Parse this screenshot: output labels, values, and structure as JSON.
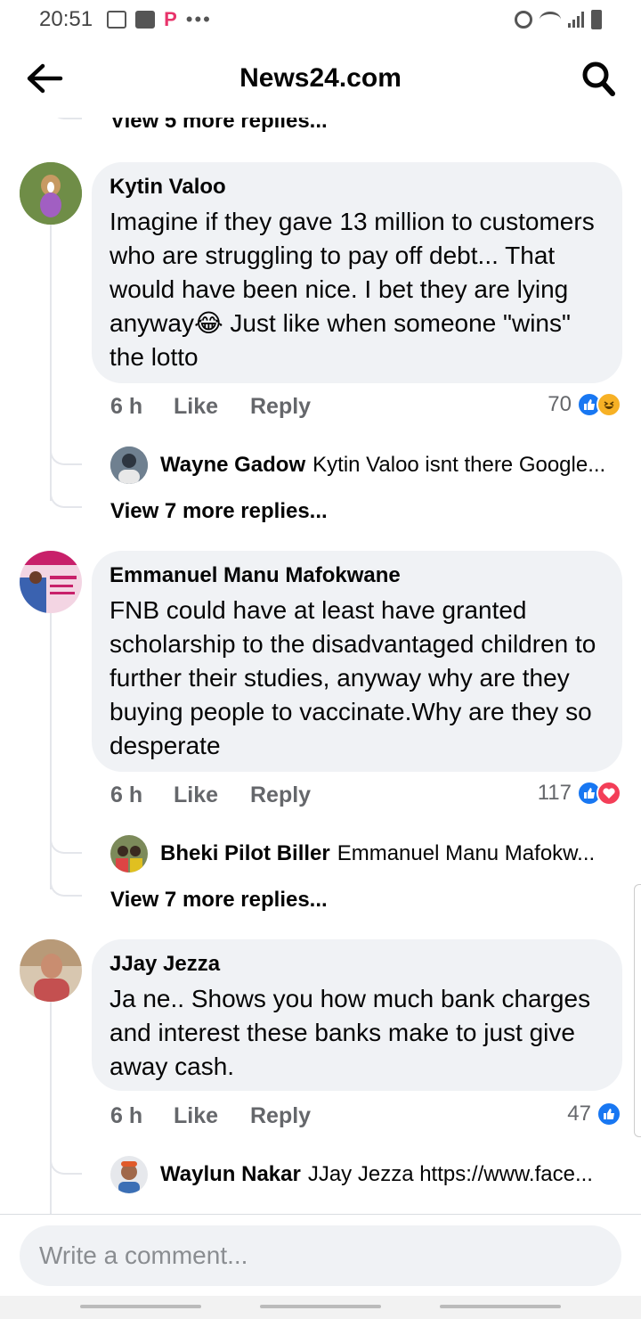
{
  "status_bar": {
    "time": "20:51",
    "extra": "•••"
  },
  "header": {
    "title": "News24.com"
  },
  "top_view_more": "View 5 more replies...",
  "comments": [
    {
      "author": "Kytin Valoo",
      "text": "Imagine if they gave 13 million to customers who are struggling to pay off debt... That would have been nice. I bet they are lying anyway😂 Just like when someone \"wins\" the lotto",
      "time": "6 h",
      "like": "Like",
      "reply": "Reply",
      "reaction_count": "70",
      "reactions": [
        "like-icon",
        "haha-icon"
      ],
      "reply_preview": {
        "author": "Wayne Gadow",
        "text": "Kytin Valoo isnt there Google..."
      },
      "view_more": "View 7 more replies..."
    },
    {
      "author": "Emmanuel Manu Mafokwane",
      "text": "FNB could have at least have granted scholarship to the disadvantaged children to further their studies, anyway why are they buying people to vaccinate.Why are they so desperate",
      "time": "6 h",
      "like": "Like",
      "reply": "Reply",
      "reaction_count": "117",
      "reactions": [
        "like-icon",
        "love-icon"
      ],
      "reply_preview": {
        "author": "Bheki Pilot Biller",
        "text": "Emmanuel Manu Mafokw..."
      },
      "view_more": "View 7 more replies..."
    },
    {
      "author": "JJay Jezza",
      "text": "Ja ne.. Shows you how much bank charges and interest these banks make to just give away cash.",
      "time": "6 h",
      "like": "Like",
      "reply": "Reply",
      "reaction_count": "47",
      "reactions": [
        "like-icon"
      ],
      "reply_preview": {
        "author": "Waylun Nakar",
        "text": "JJay Jezza https://www.face..."
      }
    }
  ],
  "composer": {
    "placeholder": "Write a comment..."
  },
  "colors": {
    "bubble": "#f0f2f5",
    "like": "#1877f2",
    "love": "#f33e58",
    "haha": "#f7b125",
    "muted": "#65676b"
  }
}
